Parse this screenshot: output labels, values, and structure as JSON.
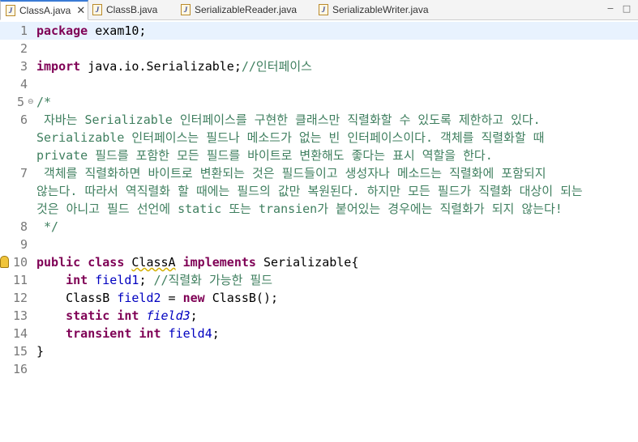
{
  "tabs": [
    {
      "label": "ClassA.java",
      "active": true,
      "icon": "java-file-icon"
    },
    {
      "label": "ClassB.java",
      "active": false,
      "icon": "java-file-icon"
    },
    {
      "label": "SerializableReader.java",
      "active": false,
      "icon": "java-file-icon"
    },
    {
      "label": "SerializableWriter.java",
      "active": false,
      "icon": "java-file-icon"
    }
  ],
  "tab_icon_glyph": "J",
  "close_glyph": "✕",
  "window_controls": {
    "minimize": "−",
    "maximize": "□"
  },
  "colors": {
    "keyword": "#7f0055",
    "comment": "#3f7f5f",
    "field": "#0000c0",
    "current_line": "#e8f2fe"
  },
  "line_numbers": [
    "1",
    "2",
    "3",
    "4",
    "5",
    "6",
    "7",
    "8",
    "9",
    "10",
    "11",
    "12",
    "13",
    "14",
    "15",
    "16"
  ],
  "code": {
    "l1_kw": "package",
    "l1_rest": " exam10;",
    "l3_kw": "import",
    "l3_rest": " java.io.Serializable;",
    "l3_cm": "//인터페이스",
    "l5": "/*",
    "l6a": " 자바는 Serializable 인터페이스를 구현한 클래스만 직렬화할 수 있도록 제한하고 있다.",
    "l6b": "Serializable 인터페이스는 필드나 메소드가 없는 빈 인터페이스이다. 객체를 직렬화할 때",
    "l6c": "private 필드를 포함한 모든 필드를 바이트로 변환해도 좋다는 표시 역할을 한다.",
    "l7a": " 객체를 직렬화하면 바이트로 변환되는 것은 필드들이고 생성자나 메소드는 직렬화에 포함되지",
    "l7b": "않는다. 따라서 역직렬화 할 때에는 필드의 값만 복원된다. 하지만 모든 필드가 직렬화 대상이 되는",
    "l7c": "것은 아니고 필드 선언에 static 또는 transien가 붙어있는 경우에는 직렬화가 되지 않는다!",
    "l8": " */",
    "l10_kw1": "public",
    "l10_kw2": "class",
    "l10_cls": "ClassA",
    "l10_kw3": "implements",
    "l10_rest": " Serializable{",
    "l11_kw": "int",
    "l11_fld": "field1",
    "l11_semi": ";",
    "l11_cm": "//직렬화 가능한 필드",
    "l12_type": "ClassB",
    "l12_fld": "field2",
    "l12_eq": " = ",
    "l12_kw": "new",
    "l12_rest": " ClassB();",
    "l13_kw1": "static",
    "l13_kw2": "int",
    "l13_fld": "field3",
    "l13_semi": ";",
    "l14_kw1": "transient",
    "l14_kw2": "int",
    "l14_fld": "field4",
    "l14_semi": ";",
    "l15": "}"
  }
}
